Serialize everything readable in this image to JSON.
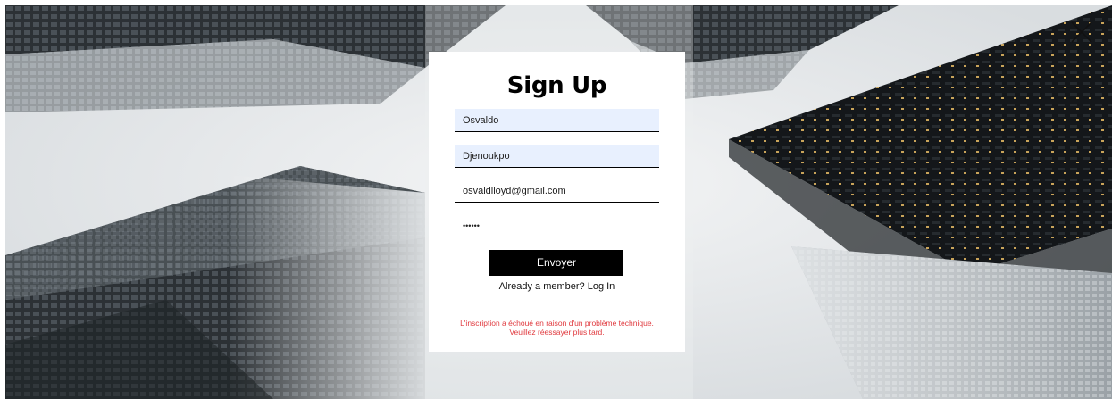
{
  "modal": {
    "title": "Sign Up",
    "first_name": {
      "value": "Osvaldo"
    },
    "last_name": {
      "value": "Djenoukpo"
    },
    "email": {
      "value": "osvaldlloyd@gmail.com"
    },
    "password": {
      "value": "••••••"
    },
    "submit_label": "Envoyer",
    "member_prompt": "Already a member? ",
    "login_link": "Log In",
    "error_line1": "L'inscription a échoué en raison d'un problème technique.",
    "error_line2": "Veuillez réessayer plus tard."
  },
  "icons": {
    "close": "close-icon"
  },
  "colors": {
    "error": "#e0393e",
    "filled_field": "#e8f0fe",
    "button": "#000000"
  }
}
